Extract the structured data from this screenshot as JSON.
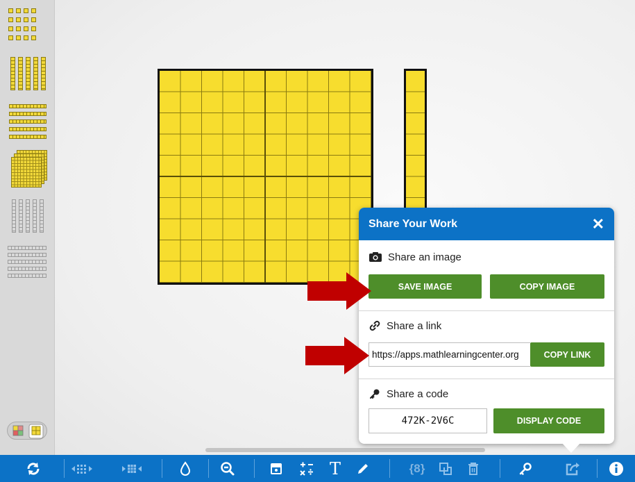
{
  "palette": {
    "items": [
      "unit-cubes-icon",
      "ten-rods-vertical-icon",
      "ten-rods-horizontal-icon",
      "hundred-flat-icon",
      "outline-rods-vertical-icon",
      "outline-rods-horizontal-icon"
    ],
    "color_toggle": "color-mode-toggle-icon"
  },
  "dialog": {
    "title": "Share Your Work",
    "close": "✕",
    "image_section": {
      "label": "Share an image",
      "save_label": "SAVE IMAGE",
      "copy_label": "COPY IMAGE"
    },
    "link_section": {
      "label": "Share a link",
      "url": "https://apps.mathlearningcenter.org",
      "copy_label": "COPY LINK"
    },
    "code_section": {
      "label": "Share a code",
      "code": "472K-2V6C",
      "display_label": "DISPLAY CODE"
    }
  },
  "toolbar": {
    "buttons": [
      "refresh-icon",
      "ungroup-icon",
      "group-icon",
      "droplet-icon",
      "zoom-out-icon",
      "image-icon",
      "operations-icon",
      "text-icon",
      "pen-icon",
      "braces-icon",
      "duplicate-icon",
      "trash-icon",
      "key-icon",
      "share-icon",
      "info-icon"
    ]
  },
  "colors": {
    "toolbar": "#0c72c6",
    "green": "#4e8e2a",
    "block_yellow": "#f7dd2e",
    "arrow_red": "#c00000"
  }
}
